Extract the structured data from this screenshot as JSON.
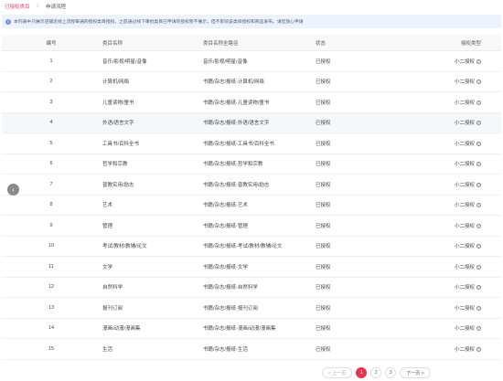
{
  "breadcrumb": {
    "link": "已授权类目",
    "current": "申请流程"
  },
  "notice": {
    "text": "本列表中只展示店铺近线上流程审通的授权类目授权。之前通过线下审批类目已申请的授权暂不展示，但不影响该类目授权和商品发布。请您放心申请"
  },
  "table": {
    "headers": {
      "index": "编号",
      "name": "类目名称",
      "path": "类目名称全路径",
      "status": "状态",
      "type": "授权类型"
    },
    "rows": [
      {
        "index": "1",
        "name": "音乐/影视/明星/音像",
        "path": "音乐/影视/明星/音像",
        "status": "已授权",
        "type": "小二授权"
      },
      {
        "index": "2",
        "name": "计算机/网络",
        "path": "书籍/杂志/报纸-计算机/网络",
        "status": "已授权",
        "type": "小二授权"
      },
      {
        "index": "3",
        "name": "儿童读物/童书",
        "path": "书籍/杂志/报纸-儿童读物/童书",
        "status": "已授权",
        "type": "小二授权"
      },
      {
        "index": "4",
        "name": "外语/语言文字",
        "path": "书籍/杂志/报纸-外语/语言文字",
        "status": "已授权",
        "type": "小二授权"
      },
      {
        "index": "5",
        "name": "工具书/百科全书",
        "path": "书籍/杂志/报纸-工具书/百科全书",
        "status": "已授权",
        "type": "小二授权"
      },
      {
        "index": "6",
        "name": "哲学和宗教",
        "path": "书籍/杂志/报纸-哲学和宗教",
        "status": "已授权",
        "type": "小二授权"
      },
      {
        "index": "7",
        "name": "普教实用/励志",
        "path": "书籍/杂志/报纸-普教实用/励志",
        "status": "已授权",
        "type": "小二授权"
      },
      {
        "index": "8",
        "name": "艺术",
        "path": "书籍/杂志/报纸-艺术",
        "status": "已授权",
        "type": "小二授权"
      },
      {
        "index": "9",
        "name": "管理",
        "path": "书籍/杂志/报纸-管理",
        "status": "已授权",
        "type": "小二授权"
      },
      {
        "index": "10",
        "name": "考试/教材/教辅/论文",
        "path": "书籍/杂志/报纸-考试/教材/教辅/论文",
        "status": "已授权",
        "type": "小二授权"
      },
      {
        "index": "11",
        "name": "文学",
        "path": "书籍/杂志/报纸-文学",
        "status": "已授权",
        "type": "小二授权"
      },
      {
        "index": "12",
        "name": "自然科学",
        "path": "书籍/杂志/报纸-自然科学",
        "status": "已授权",
        "type": "小二授权"
      },
      {
        "index": "13",
        "name": "报刊订阅",
        "path": "书籍/杂志/报纸-报刊订阅",
        "status": "已授权",
        "type": "小二授权"
      },
      {
        "index": "14",
        "name": "漫画/动漫/漫画集",
        "path": "书籍/杂志/报纸-漫画/动漫/漫画集",
        "status": "已授权",
        "type": "小二授权"
      },
      {
        "index": "15",
        "name": "生活",
        "path": "书籍/杂志/报纸-生活",
        "status": "已授权",
        "type": "小二授权"
      }
    ]
  },
  "pagination": {
    "prev": "< 上一页",
    "pages": [
      "1",
      "2",
      "3"
    ],
    "active": "1",
    "next": "下一页 >"
  },
  "icons": {
    "info": "info-icon",
    "help": "help-icon",
    "scroll": "chevron-left-icon"
  },
  "colors": {
    "accent": "#e8354f",
    "link": "#e83e5a",
    "notice_bg": "#eef2fb"
  }
}
